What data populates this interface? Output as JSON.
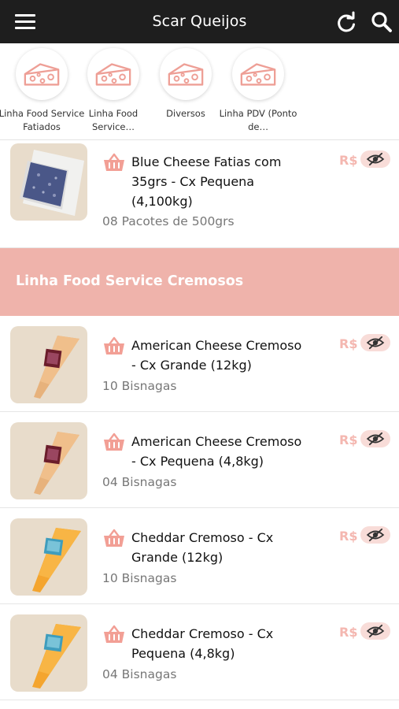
{
  "app": {
    "title": "Scar Queijos"
  },
  "header": {
    "menu_icon": "hamburger-menu-icon",
    "refresh_icon": "refresh-icon",
    "search_icon": "search-icon"
  },
  "categories": [
    {
      "label": "Linha Food Service Fatiados",
      "icon": "cheese-icon"
    },
    {
      "label": "Linha Food Service…",
      "icon": "cheese-icon"
    },
    {
      "label": "Diversos",
      "icon": "cheese-icon"
    },
    {
      "label": "Linha PDV (Ponto de…",
      "icon": "cheese-icon"
    }
  ],
  "section": {
    "title": "Linha Food Service Cremosos"
  },
  "colors": {
    "topbar": "#1e1e1e",
    "accent": "#efb3ab",
    "price": "#f4b7b0"
  },
  "products": [
    {
      "name": "Blue Cheese Fatias com 35grs - Cx Pequena (4,100kg)",
      "pack": "08 Pacotes de 500grs",
      "price_label": "R$",
      "image": "sliced-blue-cheese-package"
    },
    {
      "name": "American Cheese Cremoso - Cx Grande (12kg)",
      "pack": "10 Bisnagas",
      "price_label": "R$",
      "image": "american-cheese-piping-bag"
    },
    {
      "name": "American Cheese Cremoso - Cx Pequena (4,8kg)",
      "pack": "04 Bisnagas",
      "price_label": "R$",
      "image": "american-cheese-piping-bag"
    },
    {
      "name": "Cheddar Cremoso - Cx Grande (12kg)",
      "pack": "10 Bisnagas",
      "price_label": "R$",
      "image": "cheddar-piping-bag"
    },
    {
      "name": "Cheddar Cremoso - Cx Pequena (4,8kg)",
      "pack": "04 Bisnagas",
      "price_label": "R$",
      "image": "cheddar-piping-bag"
    }
  ]
}
